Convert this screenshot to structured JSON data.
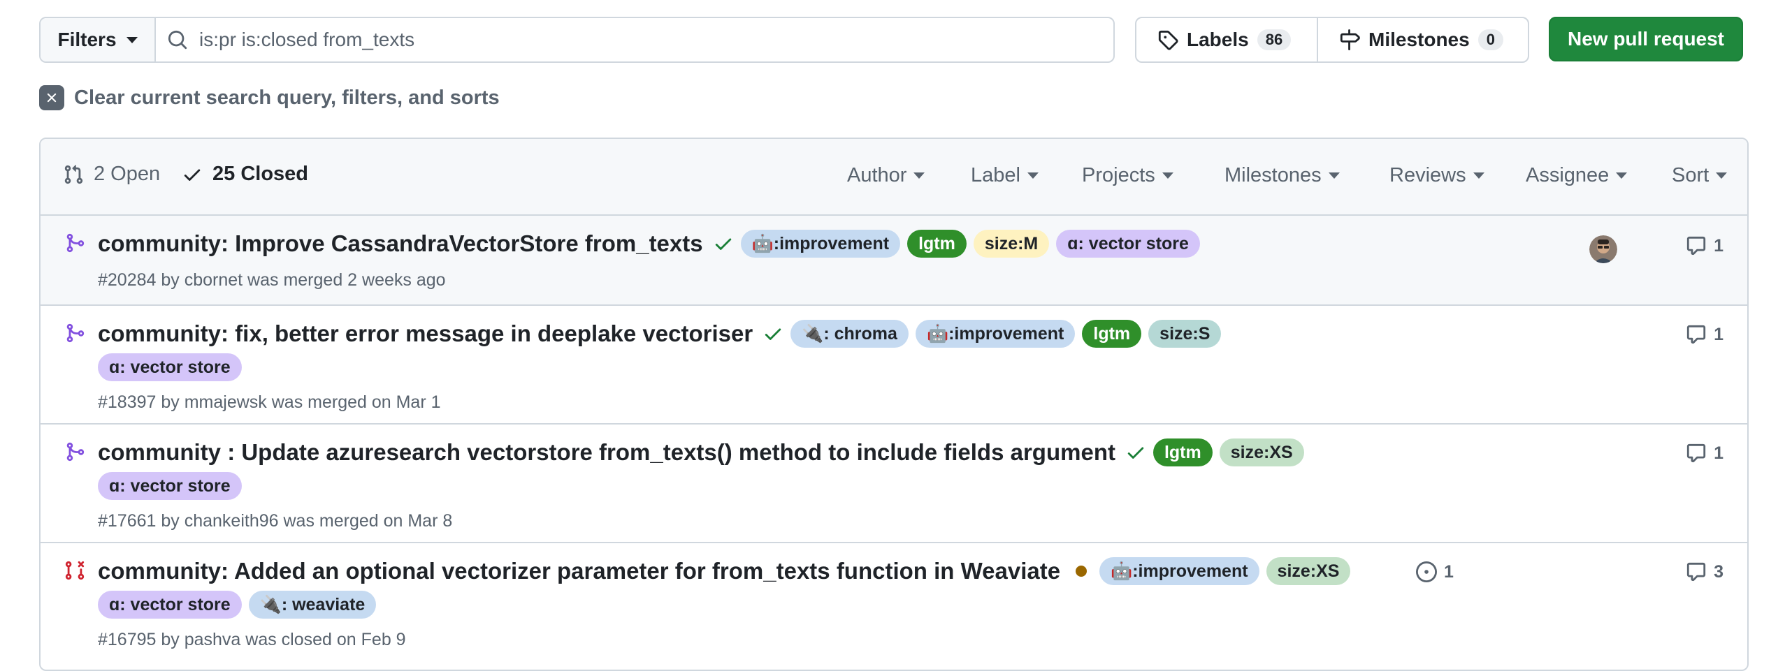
{
  "toolbar": {
    "filters_label": "Filters",
    "search_value": "is:pr is:closed from_texts",
    "labels_label": "Labels",
    "labels_count": "86",
    "milestones_label": "Milestones",
    "milestones_count": "0",
    "new_pr_label": "New pull request"
  },
  "clear_filters": "Clear current search query, filters, and sorts",
  "list_header": {
    "open_label": "2 Open",
    "closed_label": "25 Closed",
    "filters": [
      "Author",
      "Label",
      "Projects",
      "Milestones",
      "Reviews",
      "Assignee",
      "Sort"
    ]
  },
  "pull_requests": [
    {
      "title": "community: Improve CassandraVectorStore from_texts",
      "status": "merged",
      "labels": [
        ":improvement",
        "lgtm",
        "size:M",
        ": vector store"
      ],
      "meta": "#20284 by cbornet was merged 2 weeks ago",
      "comments": "1",
      "has_avatar": true
    },
    {
      "title": "community: fix, better error message in deeplake vectoriser",
      "status": "merged",
      "labels": [
        ": chroma",
        ":improvement",
        "lgtm",
        "size:S",
        ": vector store"
      ],
      "meta": "#18397 by mmajewsk was merged on Mar 1",
      "comments": "1"
    },
    {
      "title": "community : Update azuresearch vectorstore from_texts() method to include fields argument",
      "status": "merged",
      "labels": [
        "lgtm",
        "size:XS",
        ": vector store"
      ],
      "meta": "#17661 by chankeith96 was merged on Mar 8",
      "comments": "1"
    },
    {
      "title": "community: Added an optional vectorizer parameter for from_texts function in Weaviate",
      "status": "closed",
      "labels": [
        ":improvement",
        "size:XS",
        ": vector store",
        ": weaviate"
      ],
      "meta": "#16795 by pashva was closed on Feb 9",
      "linked_issues": "1",
      "comments": "3"
    }
  ],
  "colors": {
    "merged_icon": "#8250df",
    "closed_icon": "#cf222e",
    "check_green": "#1a7f37",
    "primary_button": "#1f883d",
    "pending_dot": "#9a6700"
  }
}
